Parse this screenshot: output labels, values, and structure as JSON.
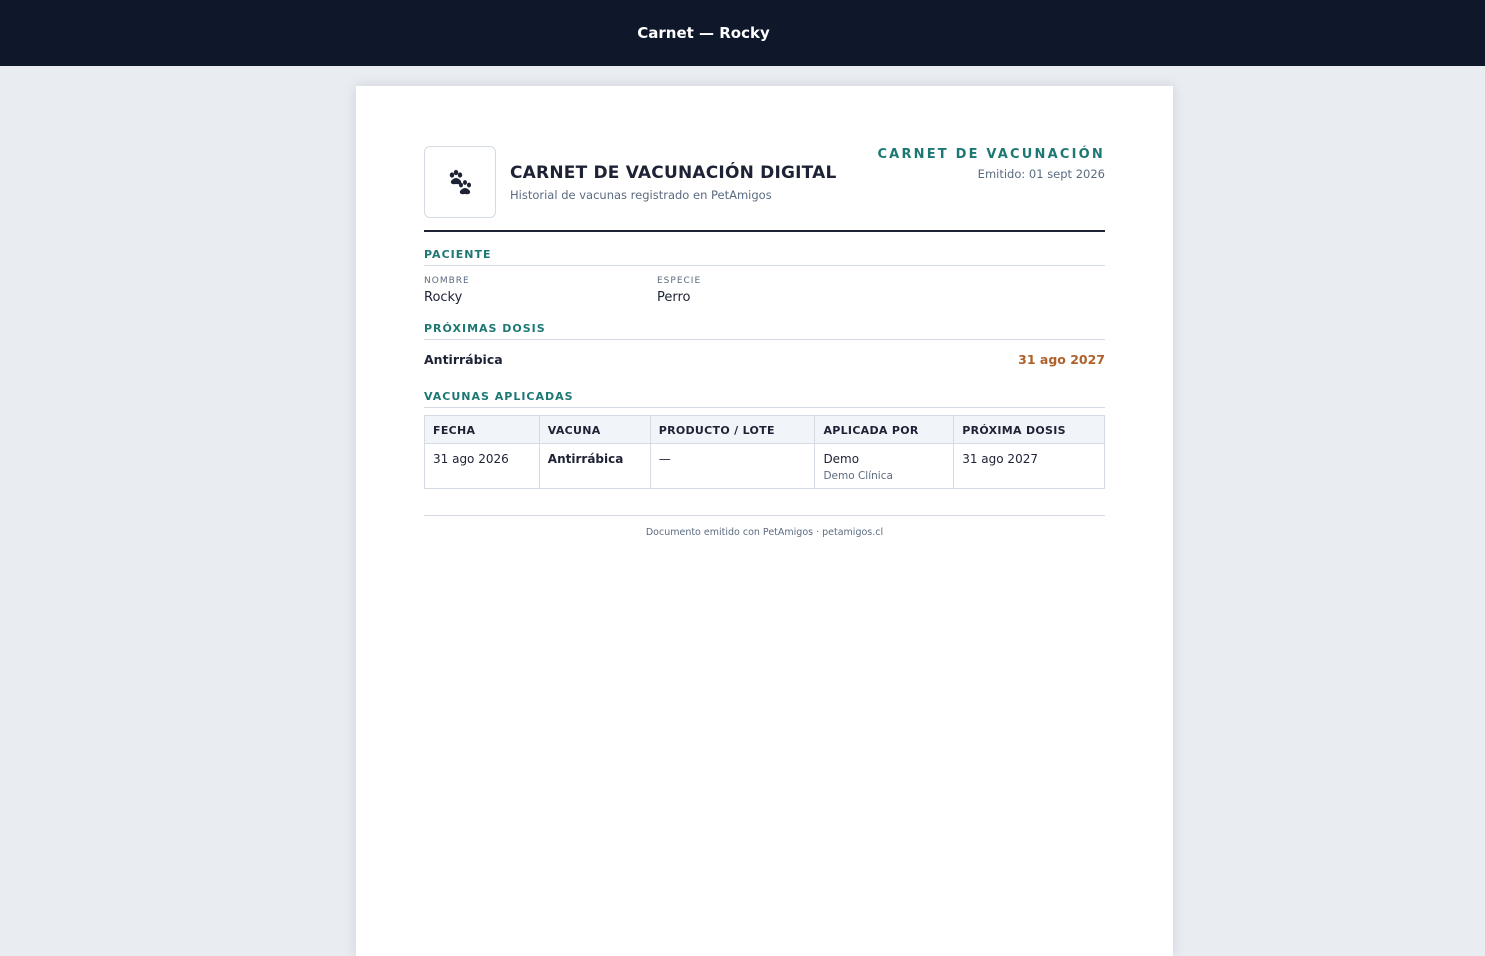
{
  "topbar": {
    "title": "Carnet — Rocky"
  },
  "header": {
    "logo_icon": "paw-icon",
    "title": "CARNET DE VACUNACIÓN DIGITAL",
    "subtitle": "Historial de vacunas registrado en PetAmigos",
    "badge": "CARNET DE VACUNACIÓN",
    "issued": "Emitido: 01 sept 2026"
  },
  "patient": {
    "heading": "PACIENTE",
    "name_label": "NOMBRE",
    "name": "Rocky",
    "species_label": "ESPECIE",
    "species": "Perro"
  },
  "upcoming": {
    "heading": "PRÓXIMAS DOSIS",
    "items": [
      {
        "vaccine": "Antirrábica",
        "date": "31 ago 2027"
      }
    ]
  },
  "applied": {
    "heading": "VACUNAS APLICADAS",
    "columns": [
      "FECHA",
      "VACUNA",
      "PRODUCTO / LOTE",
      "APLICADA POR",
      "PRÓXIMA DOSIS"
    ],
    "rows": [
      {
        "date": "31 ago 2026",
        "vaccine": "Antirrábica",
        "product": "—",
        "applied_by": "Demo",
        "clinic": "Demo Clínica",
        "next": "31 ago 2027"
      }
    ]
  },
  "footer": {
    "text": "Documento emitido con PetAmigos · petamigos.cl"
  },
  "colors": {
    "topbar": "#0f172a",
    "accent": "#1d7874",
    "due_date": "#b0602a"
  }
}
